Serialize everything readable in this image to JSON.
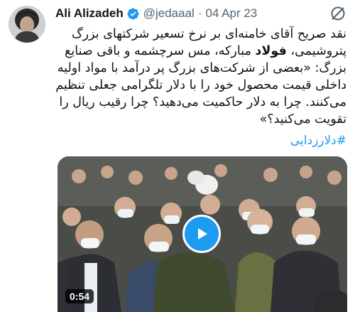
{
  "tweet": {
    "author": {
      "display_name": "Ali Alizadeh",
      "handle": "@jedaaal",
      "verified": true,
      "avatar_icon": "user-avatar"
    },
    "date": "04 Apr 23",
    "separator": "·",
    "text_line1": "نقد صریح آقای خامنه‌ای بر نرخ تسعیر شرکتهای بزرگ",
    "text_line2_pre": "پتروشیمی، ",
    "text_line2_bold": "فولاد",
    "text_line2_post": " مبارکه، مس سرچشمه و باقی صنایع",
    "text_line3": "بزرگ: «بعضی از شرکت‌های بزرگ پر درآمد با مواد اولیه",
    "text_line4": "داخلی قیمت محصول خود را با دلار تلگرامی جعلی تنظیم",
    "text_line5": "می‌کنند. چرا به دلار حاکمیت می‌دهید؟ چرا رقیب ریال را",
    "text_line6": "تقویت می‌کنید؟»",
    "hashtag": "#دلارزدایی",
    "video": {
      "duration": "0:54",
      "play_icon": "play-icon"
    },
    "grok_icon": "grok-icon"
  },
  "colors": {
    "accent": "#1d9bf0",
    "secondary_text": "#536471",
    "primary_text": "#0f1419"
  }
}
